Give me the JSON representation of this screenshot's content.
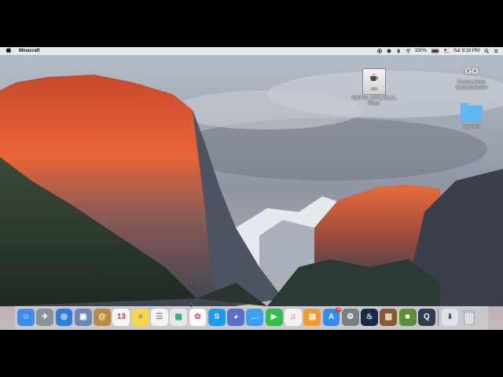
{
  "menubar": {
    "app_name": "Minecraft",
    "battery": "100%",
    "clock": "Sat 9:18 PM",
    "apple_icon": "apple-icon",
    "status_icons": [
      "record-icon",
      "volume-icon",
      "bluetooth-icon",
      "wifi-icon",
      "battery-icon",
      "flag-icon",
      "search-icon",
      "notifications-icon"
    ]
  },
  "desktop": {
    "file_icon_text": "JAR",
    "file_label": "OptiFine_1.8.9_HD_U_H8.jar",
    "csgo_glyph": "GO",
    "csgo_label": "Counter-Strike Global Offensive",
    "folder_label": "new shit"
  },
  "dock": {
    "items": [
      {
        "name": "Finder",
        "color": "#3d8ee8",
        "glyph": "☺"
      },
      {
        "name": "Launchpad",
        "color": "#8a9099",
        "glyph": "✈"
      },
      {
        "name": "Safari",
        "color": "#2b7de0",
        "glyph": "◎"
      },
      {
        "name": "Preview",
        "color": "#6a87b5",
        "glyph": "▣"
      },
      {
        "name": "Contacts",
        "color": "#b8893e",
        "glyph": "@"
      },
      {
        "name": "Calendar",
        "color": "#f7f7f7",
        "glyph": "13",
        "fg": "#d33"
      },
      {
        "name": "Notes",
        "color": "#f5d84a",
        "glyph": "≡",
        "fg": "#777"
      },
      {
        "name": "Reminders",
        "color": "#f4f4f4",
        "glyph": "☰",
        "fg": "#888"
      },
      {
        "name": "Photo Booth",
        "color": "#e8e8e8",
        "glyph": "▦",
        "fg": "#2a7"
      },
      {
        "name": "Photos",
        "color": "#ffffff",
        "glyph": "✿",
        "fg": "#e49"
      },
      {
        "name": "Skype",
        "color": "#1d9bf0",
        "glyph": "S"
      },
      {
        "name": "Discord",
        "color": "#5b70c9",
        "glyph": "◕"
      },
      {
        "name": "Messages",
        "color": "#3aa1f5",
        "glyph": "…"
      },
      {
        "name": "FaceTime",
        "color": "#2fbf4a",
        "glyph": "▶"
      },
      {
        "name": "iTunes",
        "color": "#f2f2f2",
        "glyph": "♫",
        "fg": "#e3418c"
      },
      {
        "name": "iBooks",
        "color": "#f29a2e",
        "glyph": "▤"
      },
      {
        "name": "App Store",
        "color": "#2f8df0",
        "glyph": "A",
        "badge": "1"
      },
      {
        "name": "System Preferences",
        "color": "#7b7f86",
        "glyph": "⚙"
      },
      {
        "name": "Steam",
        "color": "#1b2a44",
        "glyph": "♨"
      },
      {
        "name": "Chest",
        "color": "#8a5b2c",
        "glyph": "▥"
      },
      {
        "name": "Minecraft",
        "color": "#5c8f3a",
        "glyph": "■"
      },
      {
        "name": "QuickTime",
        "color": "#2e3c52",
        "glyph": "Q"
      }
    ],
    "downloads_label": "Downloads",
    "trash_label": "Trash"
  }
}
